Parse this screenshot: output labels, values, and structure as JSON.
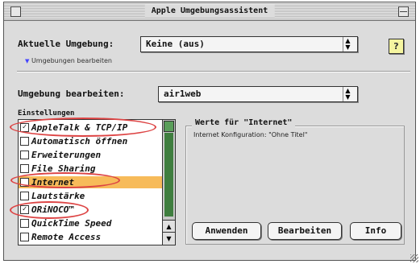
{
  "window": {
    "title": "Apple Umgebungsassistent"
  },
  "current_environment": {
    "label": "Aktuelle Umgebung:",
    "value": "Keine (aus)"
  },
  "help_button": "?",
  "edit_environments": {
    "label": "Umgebungen bearbeiten"
  },
  "edit_environment": {
    "label": "Umgebung bearbeiten:",
    "value": "air1web"
  },
  "settings": {
    "label": "Einstellungen",
    "items": [
      {
        "label": "AppleTalk & TCP/IP",
        "checked": true
      },
      {
        "label": "Automatisch öffnen",
        "checked": false
      },
      {
        "label": "Erweiterungen",
        "checked": false
      },
      {
        "label": "File Sharing",
        "checked": false
      },
      {
        "label": "Internet",
        "checked": false,
        "selected": true
      },
      {
        "label": "Lautstärke",
        "checked": false
      },
      {
        "label": "ORiNOCO™",
        "checked": true
      },
      {
        "label": "QuickTime Speed",
        "checked": false
      },
      {
        "label": "Remote Access",
        "checked": false
      }
    ]
  },
  "values_panel": {
    "title": "Werte für \"Internet\"",
    "info": "Internet Konfiguration: \"Ohne Titel\""
  },
  "buttons": {
    "apply": "Anwenden",
    "edit": "Bearbeiten",
    "info": "Info"
  },
  "colors": {
    "selection": "#f7bb5a",
    "scroll_green": "#3f7e3f",
    "annotation_red": "#dd4444"
  }
}
